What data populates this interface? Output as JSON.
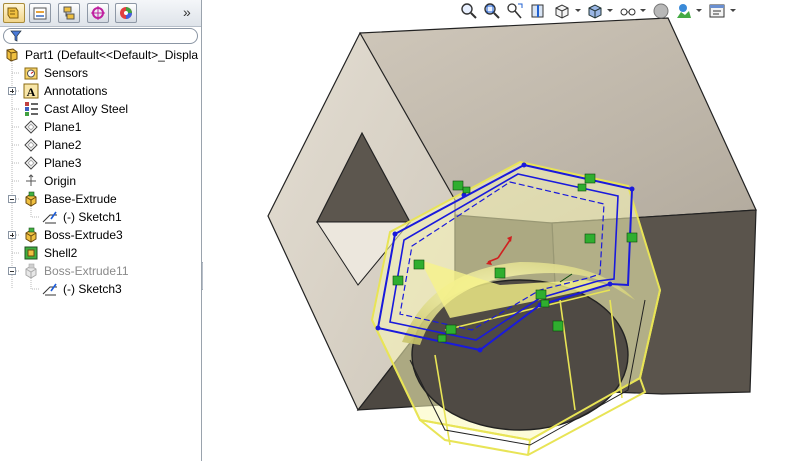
{
  "feature_tree": {
    "items": [
      {
        "label": "Part1  (Default<<Default>_Displa",
        "icon": "part-icon",
        "expander": "none"
      },
      {
        "label": "Sensors",
        "icon": "sensors-icon",
        "expander": "none"
      },
      {
        "label": "Annotations",
        "icon": "annotations-icon",
        "expander": "plus"
      },
      {
        "label": "Cast Alloy Steel",
        "icon": "material-icon",
        "expander": "none"
      },
      {
        "label": "Plane1",
        "icon": "plane-icon",
        "expander": "none"
      },
      {
        "label": "Plane2",
        "icon": "plane-icon",
        "expander": "none"
      },
      {
        "label": "Plane3",
        "icon": "plane-icon",
        "expander": "none"
      },
      {
        "label": "Origin",
        "icon": "origin-icon",
        "expander": "none"
      },
      {
        "label": "Base-Extrude",
        "icon": "extrude-icon",
        "expander": "minus"
      },
      {
        "label": "(-) Sketch1",
        "icon": "sketch-icon",
        "expander": "none"
      },
      {
        "label": "Boss-Extrude3",
        "icon": "extrude-icon",
        "expander": "plus"
      },
      {
        "label": "Shell2",
        "icon": "shell-icon",
        "expander": "none"
      },
      {
        "label": "Boss-Extrude11",
        "icon": "extrude-icon",
        "expander": "minus",
        "state": "dimmed"
      },
      {
        "label": "(-) Sketch3",
        "icon": "sketch-icon",
        "expander": "none"
      }
    ]
  },
  "panel_tabs": [
    "featuremanager-tab-icon",
    "propertymanager-tab-icon",
    "configurationmanager-tab-icon",
    "dimxpert-tab-icon",
    "appearances-tab-icon"
  ],
  "heads_up_toolbar": [
    "zoom-to-fit-icon",
    "zoom-to-area-icon",
    "previous-view-icon",
    "section-view-icon",
    "view-orientation-icon",
    "display-style-icon",
    "hide-show-items-icon",
    "edit-appearance-icon",
    "apply-scene-icon",
    "view-settings-icon"
  ],
  "colors": {
    "model_face_light": "#d8d1c4",
    "model_face_mid": "#b9b1a4",
    "model_face_dark": "#4d4842",
    "preview_yellow": "#f4f26a",
    "sketch_blue": "#1a1adc",
    "relation_green": "#2fae2f"
  }
}
